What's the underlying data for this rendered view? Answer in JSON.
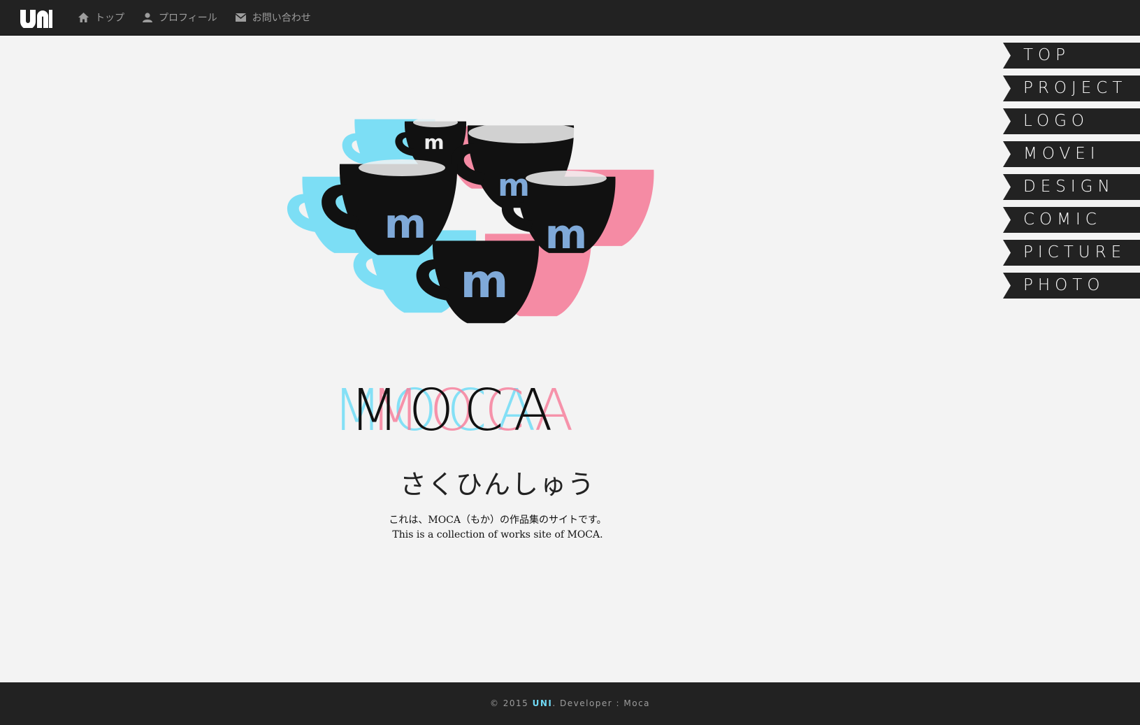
{
  "header": {
    "brand": "uni",
    "nav": [
      {
        "label": "トップ",
        "icon": "home-icon"
      },
      {
        "label": "プロフィール",
        "icon": "user-icon"
      },
      {
        "label": "お問い合わせ",
        "icon": "mail-icon"
      }
    ]
  },
  "side_menu": {
    "items": [
      "TOP",
      "PROJECT",
      "LOGO",
      "MOVEI",
      "DESIGN",
      "COMIC",
      "PICTURE",
      "PHOTO"
    ]
  },
  "hero": {
    "logo_letter": "m",
    "title": "MOCA",
    "subtitle": "さくひんしゅう",
    "description_ja": "これは、MOCA（もか）の作品集のサイトです。",
    "description_en": "This is a collection of works site of MOCA."
  },
  "footer": {
    "prefix": "© 2015 ",
    "accent": "UNI",
    "suffix": ". Developer : Moca"
  },
  "colors": {
    "dark": "#222222",
    "cyan": "#70dcf6",
    "pink": "#f6809c",
    "black": "#111111",
    "background": "#f3f3f3"
  }
}
